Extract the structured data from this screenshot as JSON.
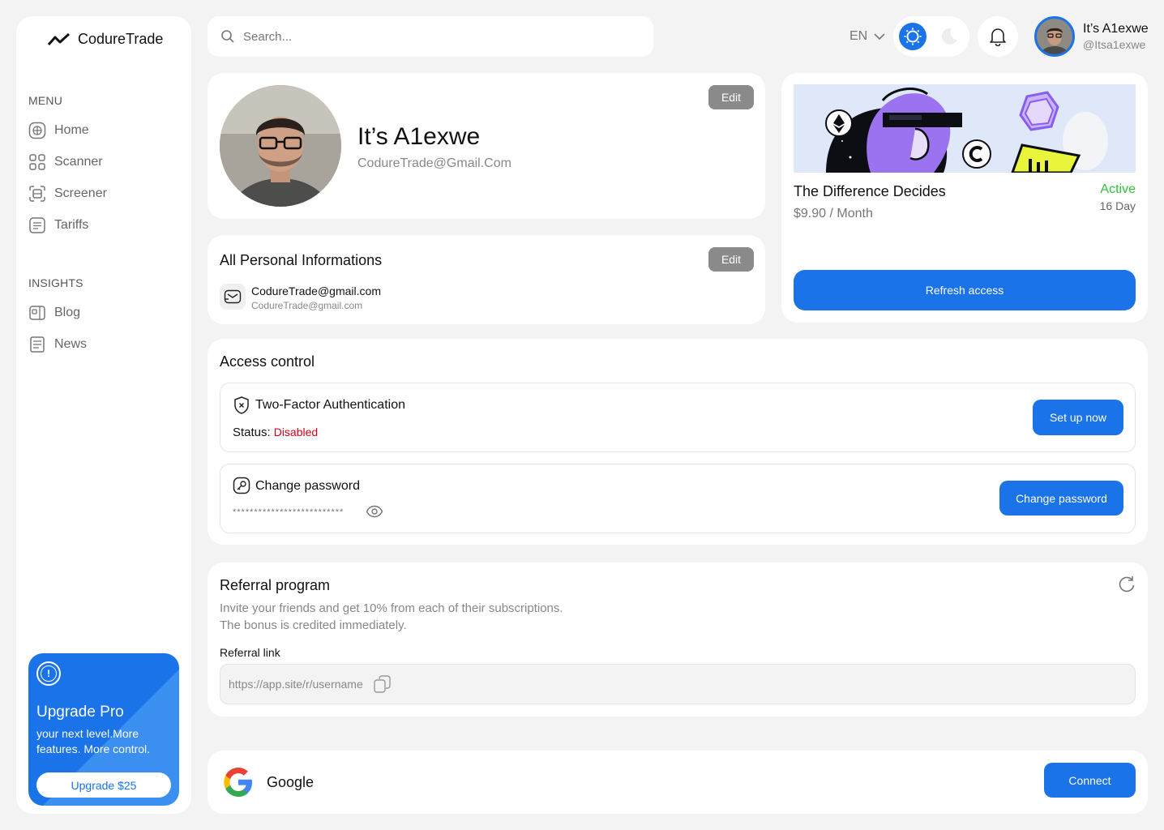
{
  "brand": {
    "name": "CodureTrade"
  },
  "sidebar": {
    "menu_label": "MENU",
    "menu_items": [
      {
        "label": "Home",
        "icon": "home-icon"
      },
      {
        "label": "Scanner",
        "icon": "scanner-icon"
      },
      {
        "label": "Screener",
        "icon": "screener-icon"
      },
      {
        "label": "Tariffs",
        "icon": "tariffs-icon"
      }
    ],
    "insights_label": "INSIGHTS",
    "insights_items": [
      {
        "label": "Blog",
        "icon": "blog-icon"
      },
      {
        "label": "News",
        "icon": "news-icon"
      }
    ],
    "upgrade": {
      "title": "Upgrade Pro",
      "subtitle": "your next level.More features. More control.",
      "button": "Upgrade $25"
    }
  },
  "topbar": {
    "search_placeholder": "Search...",
    "language": "EN",
    "user_name": "It’s A1exwe",
    "user_handle": "@Itsa1exwe"
  },
  "profile": {
    "name": "It’s A1exwe",
    "email": "CodureTrade@Gmail.Com",
    "edit_label": "Edit"
  },
  "personal_info": {
    "title": "All Personal Informations",
    "edit_label": "Edit",
    "email_primary": "CodureTrade@gmail.com",
    "email_secondary": "CodureTrade@gmail.com"
  },
  "plan": {
    "title": "The Difference Decides",
    "price": "$9.90 / Month",
    "status": "Active",
    "days": "16 Day",
    "button": "Refresh access"
  },
  "access_control": {
    "title": "Access control",
    "two_factor": {
      "title": "Two-Factor Authentication",
      "status_label": "Status:",
      "status_value": "Disabled",
      "button": "Set up now"
    },
    "password": {
      "title": "Change password",
      "masked": "**************************",
      "button": "Change password"
    }
  },
  "referral": {
    "title": "Referral program",
    "desc_line1": "Invite your friends and get 10% from each of their subscriptions.",
    "desc_line2": "The bonus is credited immediately.",
    "link_label": "Referral link",
    "link_placeholder": "https://app.site/r/username"
  },
  "google": {
    "name": "Google",
    "button": "Connect"
  },
  "colors": {
    "accent": "#1a73e8",
    "active": "#34c03a",
    "disabled": "#d0021b",
    "background": "#f3f3f3"
  }
}
